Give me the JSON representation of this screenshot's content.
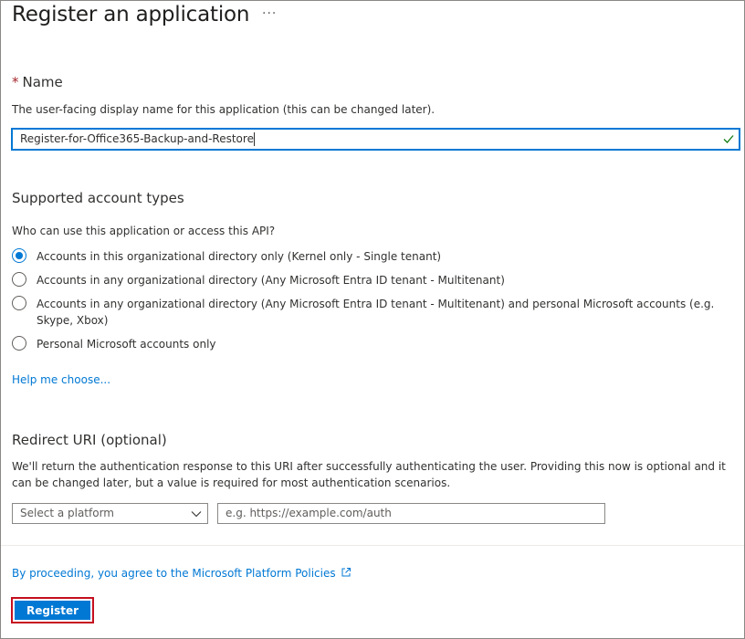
{
  "header": {
    "title": "Register an application",
    "more": "···"
  },
  "name_section": {
    "required_mark": "*",
    "label": "Name",
    "description": "The user-facing display name for this application (this can be changed later).",
    "input_value": "Register-for-Office365-Backup-and-Restore"
  },
  "account_types": {
    "label": "Supported account types",
    "question": "Who can use this application or access this API?",
    "options": [
      {
        "label": "Accounts in this organizational directory only (Kernel only - Single tenant)",
        "checked": true
      },
      {
        "label": "Accounts in any organizational directory (Any Microsoft Entra ID tenant - Multitenant)",
        "checked": false
      },
      {
        "label": "Accounts in any organizational directory (Any Microsoft Entra ID tenant - Multitenant) and personal Microsoft accounts (e.g. Skype, Xbox)",
        "checked": false
      },
      {
        "label": "Personal Microsoft accounts only",
        "checked": false
      }
    ],
    "help_link": "Help me choose..."
  },
  "redirect": {
    "label": "Redirect URI (optional)",
    "description": "We'll return the authentication response to this URI after successfully authenticating the user. Providing this now is optional and it can be changed later, but a value is required for most authentication scenarios.",
    "platform_placeholder": "Select a platform",
    "uri_placeholder": "e.g. https://example.com/auth"
  },
  "footer": {
    "policy_link": "By proceeding, you agree to the Microsoft Platform Policies",
    "register_label": "Register"
  },
  "colors": {
    "accent": "#0078d4",
    "required": "#a4262c",
    "highlight": "#c50f1f",
    "success": "#107c10"
  }
}
